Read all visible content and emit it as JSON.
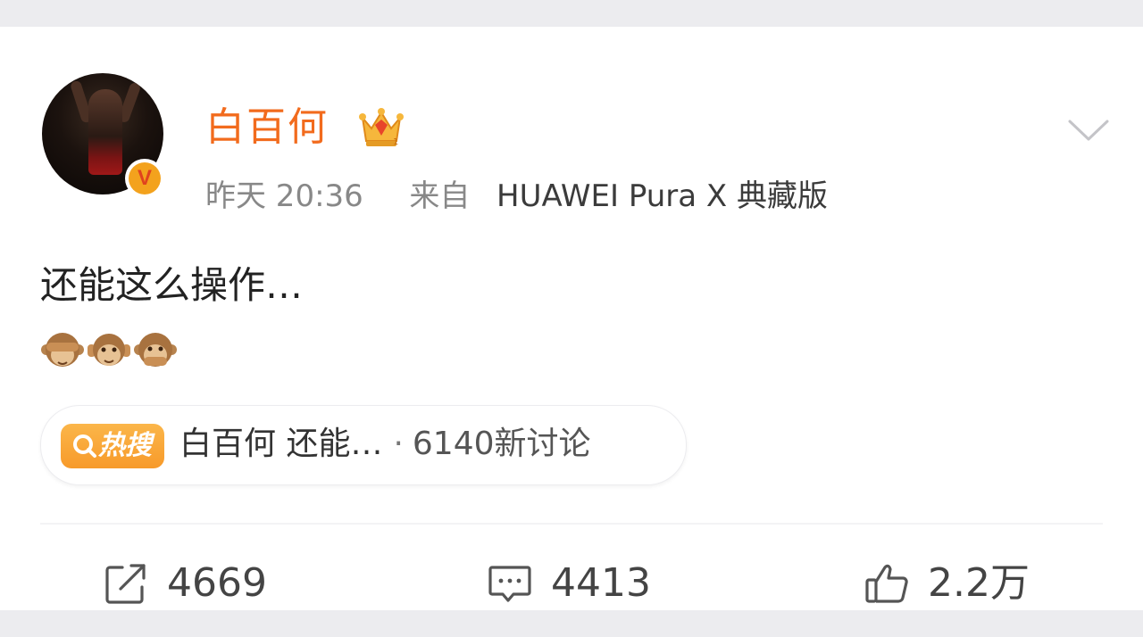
{
  "post": {
    "author": {
      "name": "白百何",
      "verified_badge": "V",
      "crown_icon": "crown-icon"
    },
    "meta": {
      "time": "昨天 20:36",
      "source_prefix": "来自",
      "device": "HUAWEI Pura X 典藏版"
    },
    "text": "还能这么操作…",
    "emojis": [
      "see-no-evil-monkey",
      "hear-no-evil-monkey",
      "speak-no-evil-monkey"
    ],
    "hot_search": {
      "badge_label": "热搜",
      "title": "白百何 还能…",
      "separator": "·",
      "count": "6140新讨论"
    },
    "actions": {
      "repost": "4669",
      "comment": "4413",
      "like": "2.2万"
    }
  },
  "colors": {
    "username": "#f26b1d",
    "hot_badge": "#f79a2a",
    "text": "#222222",
    "meta": "#888888"
  }
}
